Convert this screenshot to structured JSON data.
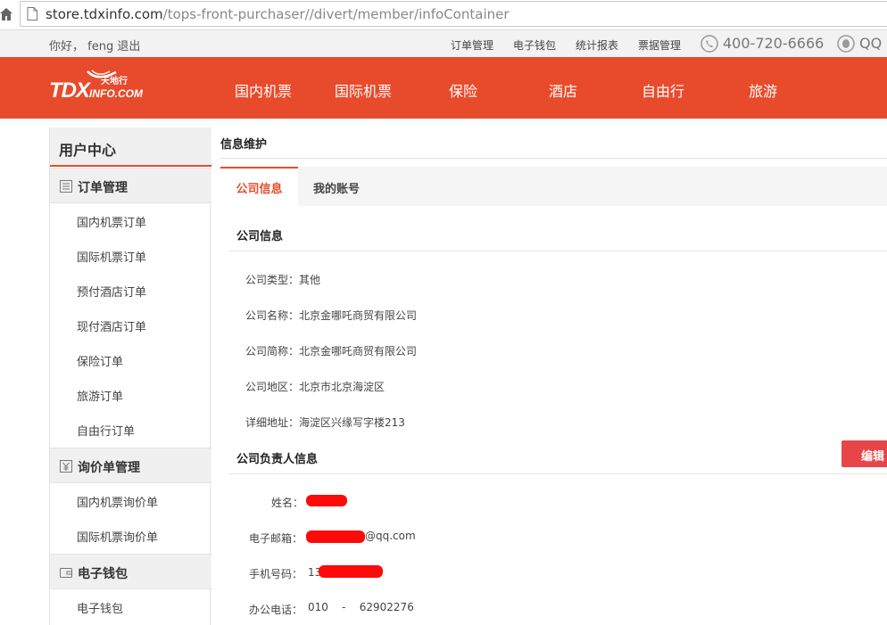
{
  "browser": {
    "url_host": "store.tdxinfo.com",
    "url_path": "/tops-front-purchaser//divert/member/infoContainer"
  },
  "topbar": {
    "greeting": "你好， feng 退出",
    "links": [
      "订单管理",
      "电子钱包",
      "统计报表",
      "票据管理"
    ],
    "phone": "400-720-6666",
    "qq": "QQ"
  },
  "logo": {
    "main": "TDX",
    "sub": "INFO.COM",
    "cn": "天地行"
  },
  "nav": {
    "items": [
      "国内机票",
      "国际机票",
      "保险",
      "酒店",
      "自由行",
      "旅游"
    ]
  },
  "sidebar": {
    "title": "用户中心",
    "groups": [
      {
        "label": "订单管理",
        "icon": "list-icon",
        "items": [
          "国内机票订单",
          "国际机票订单",
          "预付酒店订单",
          "现付酒店订单",
          "保险订单",
          "旅游订单",
          "自由行订单"
        ]
      },
      {
        "label": "询价单管理",
        "icon": "yen-icon",
        "items": [
          "国内机票询价单",
          "国际机票询价单"
        ]
      },
      {
        "label": "电子钱包",
        "icon": "wallet-icon",
        "items": [
          "电子钱包"
        ]
      }
    ]
  },
  "content": {
    "title": "信息维护",
    "tabs": [
      "公司信息",
      "我的账号"
    ],
    "company_section": {
      "title": "公司信息",
      "fields": [
        "公司类型：其他",
        "公司名称：北京金哪吒商贸有限公司",
        "公司简称：北京金哪吒商贸有限公司",
        "公司地区：北京市北京海淀区",
        "详细地址：海淀区兴缘写字楼213"
      ]
    },
    "contact_section": {
      "title": "公司负责人信息",
      "edit_label": "编辑",
      "fields": [
        {
          "label": "姓名：",
          "value": ""
        },
        {
          "label": "电子邮箱：",
          "value": "@qq.com"
        },
        {
          "label": "手机号码：",
          "value": "13"
        },
        {
          "label": "办公电话：",
          "value": "010    -    62902276"
        }
      ]
    }
  },
  "colors": {
    "brand_red": "#e84b2c",
    "edit_red": "#e8454a",
    "redaction": "#ff0a0a"
  }
}
